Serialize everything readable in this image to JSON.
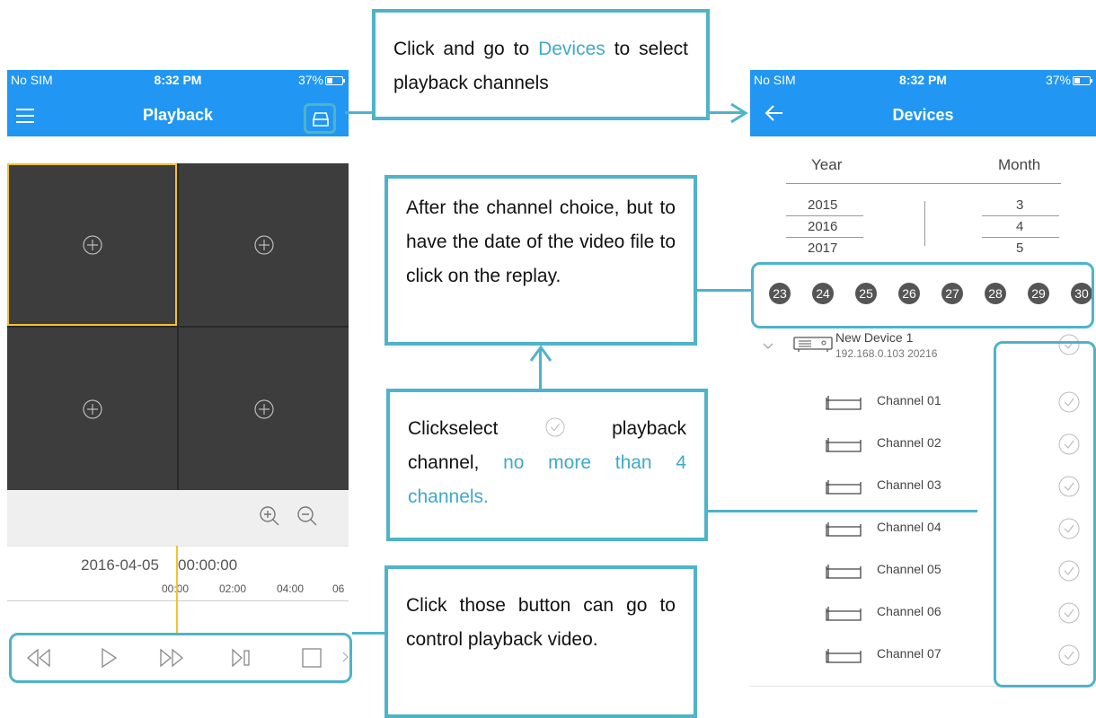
{
  "left_phone": {
    "status": {
      "carrier": "No SIM",
      "time": "8:32 PM",
      "battery": "37%"
    },
    "title": "Playback",
    "timeline": {
      "date": "2016-04-05",
      "time": "00:00:00",
      "ticks": [
        "00:00",
        "02:00",
        "04:00",
        "06"
      ]
    }
  },
  "right_phone": {
    "status": {
      "carrier": "No SIM",
      "time": "8:32 PM",
      "battery": "37%"
    },
    "title": "Devices",
    "picker": {
      "year_label": "Year",
      "month_label": "Month",
      "years": [
        "2015",
        "2016",
        "2017"
      ],
      "months": [
        "3",
        "4",
        "5"
      ]
    },
    "days": [
      "23",
      "24",
      "25",
      "26",
      "27",
      "28",
      "29",
      "30"
    ],
    "device": {
      "name": "New Device 1",
      "address": "192.168.0.103  20216"
    },
    "channels": [
      "Channel 01",
      "Channel 02",
      "Channel 03",
      "Channel 04",
      "Channel 05",
      "Channel 06",
      "Channel 07"
    ]
  },
  "callouts": {
    "devices": {
      "part1": "Click and go to ",
      "highlight": "Devices",
      "part2": " to select playback channels"
    },
    "date": "After the channel choice, but to have the date of the video file to click on the replay.",
    "channels": {
      "part1": "Clickselect",
      "part2": " playback channel, ",
      "highlight": "no more than 4 channels."
    },
    "controls": "Click those button can go to control playback video."
  },
  "colors": {
    "nav_blue": "#2196f3",
    "accent_teal": "#4fb3c9",
    "highlight_text": "#3fa9c8",
    "selected_cell": "#f2c230"
  }
}
